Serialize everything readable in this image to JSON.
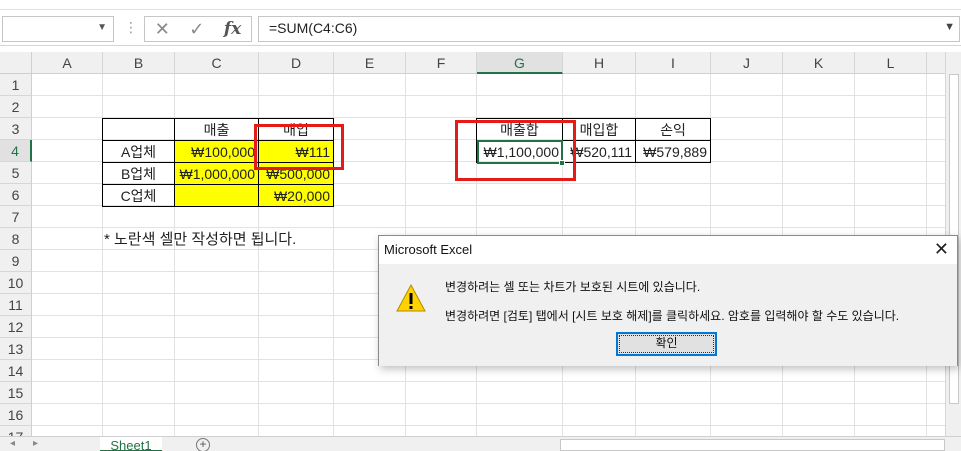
{
  "formula_bar": {
    "name_box": "",
    "formula": "=SUM(C4:C6)"
  },
  "columns": [
    "A",
    "B",
    "C",
    "D",
    "E",
    "F",
    "G",
    "H",
    "I",
    "J",
    "K",
    "L"
  ],
  "rows": [
    "1",
    "2",
    "3",
    "4",
    "5",
    "6",
    "7",
    "8",
    "9",
    "10",
    "11",
    "12",
    "13",
    "14",
    "15",
    "16",
    "17"
  ],
  "selected_column": "G",
  "selected_row": "4",
  "table1": {
    "header_sales": "매출",
    "header_purchase": "매입",
    "row_a": {
      "label": "A업체",
      "sales": "₩100,000",
      "purchase": "₩111"
    },
    "row_b": {
      "label": "B업체",
      "sales": "₩1,000,000",
      "purchase": "₩500,000"
    },
    "row_c": {
      "label": "C업체",
      "sales": "",
      "purchase": "₩20,000"
    }
  },
  "table2": {
    "header_sales_total": "매출합",
    "header_purchase_total": "매입합",
    "header_profit": "손익",
    "sales_total": "₩1,100,000",
    "purchase_total": "₩520,111",
    "profit": "₩579,889"
  },
  "note": "* 노란색 셀만 작성하면 됩니다.",
  "sheet_tabs": [
    "Sheet1"
  ],
  "dialog": {
    "title": "Microsoft Excel",
    "message_line1": "변경하려는 셀 또는 차트가 보호된 시트에 있습니다.",
    "message_line2": "변경하려면 [검토] 탭에서 [시트 보호 해제]를 클릭하세요. 암호를 입력해야 할 수도 있습니다.",
    "ok_label": "확인"
  },
  "colors": {
    "highlight_yellow": "#ffff00",
    "excel_green": "#217346",
    "annotation_red": "#e41b17",
    "focus_blue": "#0078d7"
  }
}
